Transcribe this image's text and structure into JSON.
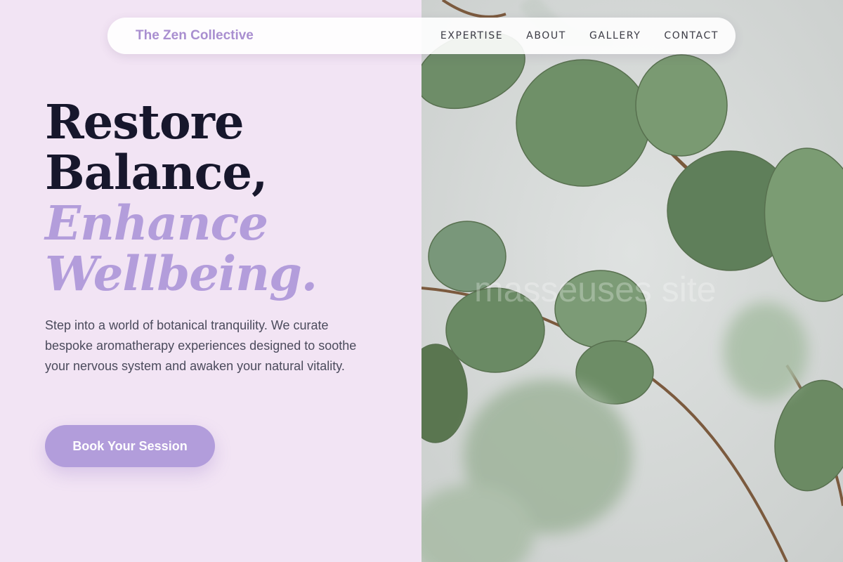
{
  "brand": {
    "name": "The Zen Collective"
  },
  "nav": {
    "items": [
      {
        "label": "EXPERTISE"
      },
      {
        "label": "ABOUT"
      },
      {
        "label": "GALLERY"
      },
      {
        "label": "CONTACT"
      }
    ]
  },
  "hero": {
    "headline": {
      "line1": "Restore",
      "line2": "Balance,",
      "line3": "Enhance",
      "line4": "Wellbeing."
    },
    "description": "Step into a world of botanical tranquility. We curate bespoke aromatherapy experiences designed to soothe your nervous system and awaken your natural vitality.",
    "cta_label": "Book Your Session"
  },
  "image": {
    "watermark": "masseuses site"
  },
  "colors": {
    "background": "#f2e4f4",
    "accent": "#b39ddb",
    "heading": "#17172c",
    "body_text": "#4b4b5c",
    "leaf_green": "#6e8d68"
  }
}
